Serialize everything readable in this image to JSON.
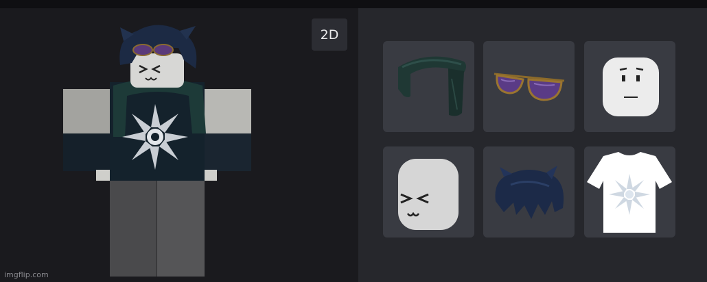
{
  "preview": {
    "view_toggle_label": "2D"
  },
  "watermark": "imgflip.com",
  "inventory": {
    "items": [
      {
        "name": "green-scarf",
        "icon": "scarf-icon"
      },
      {
        "name": "purple-aviator-sunglasses",
        "icon": "sunglasses-icon"
      },
      {
        "name": "plain-face-head",
        "icon": "head-icon"
      },
      {
        "name": "squint-face-head",
        "icon": "head-icon"
      },
      {
        "name": "dark-blue-messy-hair",
        "icon": "hair-icon"
      },
      {
        "name": "white-sun-tshirt",
        "icon": "tshirt-icon"
      }
    ]
  }
}
